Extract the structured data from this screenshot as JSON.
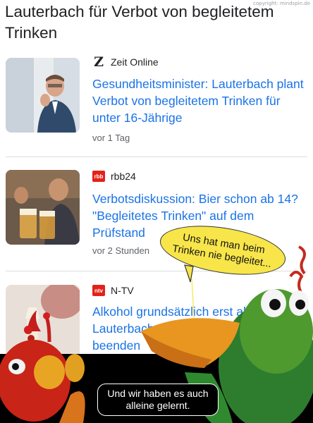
{
  "copyright": "copyright: mindspin.de",
  "headline": "Lauterbach für Verbot von begleitetem Trinken",
  "articles": [
    {
      "source": "Zeit Online",
      "source_icon": "zeit-z-logo",
      "title": "Gesundheitsminister: Lauterbach plant Verbot von begleitetem Trinken für unter 16-Jährige",
      "time": "vor 1 Tag"
    },
    {
      "source": "rbb24",
      "source_icon": "rbb-logo",
      "source_badge": "rbb",
      "title": "Verbotsdiskussion: Bier schon ab 14? \"Begleitetes Trinken\" auf dem Prüfstand",
      "time": "vor 2 Stunden"
    },
    {
      "source": "N-TV",
      "source_icon": "ntv-logo",
      "source_badge": "ntv",
      "title": "Alkohol grundsätzlich erst ab 18? Lauterbach will begleitetes Trinken beenden"
    }
  ],
  "cartoon": {
    "speech_yellow": "Uns hat man beim Trinken nie begleitet...",
    "speech_black": "Und wir haben es auch alleine gelernt."
  },
  "colors": {
    "link": "#1a73e8",
    "bubble_yellow": "#f7e54a",
    "ntv_red": "#e2231a"
  }
}
